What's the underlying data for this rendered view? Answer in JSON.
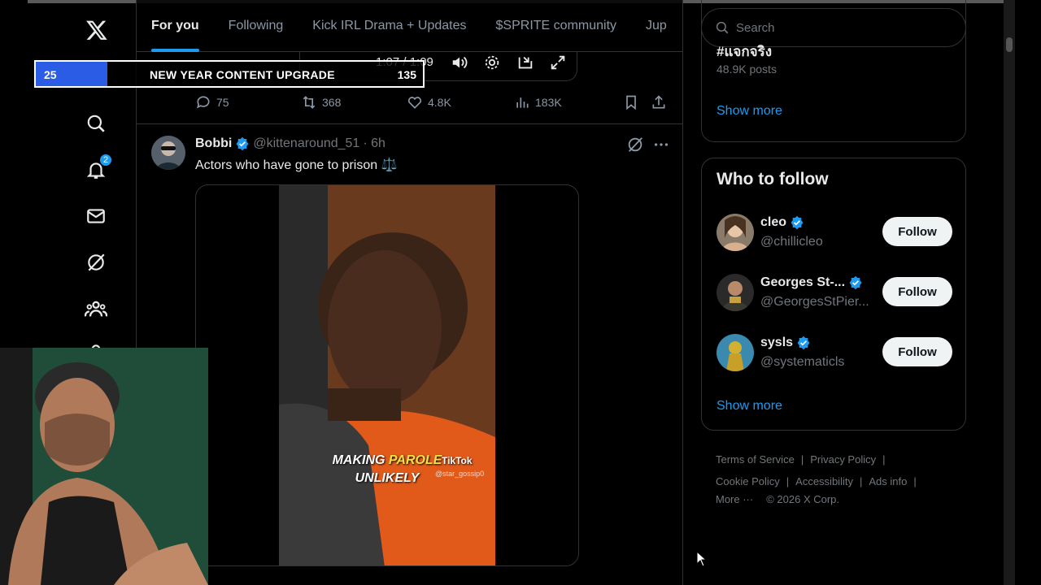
{
  "stream_overlay": {
    "current": "25",
    "goal": "135",
    "label": "NEW YEAR CONTENT UPGRADE",
    "progress": 0.185
  },
  "nav": {
    "notifications_badge": "2",
    "icons": [
      "x-logo-icon",
      "home-icon",
      "search-icon",
      "bell-icon",
      "mail-icon",
      "grok-icon",
      "communities-icon",
      "profile-icon"
    ]
  },
  "tabs": [
    {
      "label": "For you",
      "active": true
    },
    {
      "label": "Following"
    },
    {
      "label": "Kick IRL Drama + Updates"
    },
    {
      "label": "$SPRITE community"
    },
    {
      "label": "Jup"
    }
  ],
  "video_player": {
    "time": "1:07 / 1:09"
  },
  "prev_post_actions": {
    "replies": "75",
    "reposts": "368",
    "likes": "4.8K",
    "views": "183K"
  },
  "post": {
    "name": "Bobbi",
    "handle": "@kittenaround_51",
    "time": "· 6h",
    "text": "Actors who have gone to prison ⚖️",
    "caption_line1_a": "MAKING ",
    "caption_line1_b": "PAROLE",
    "caption_line2": "UNLIKELY",
    "tiktok": "TikTok",
    "tiktok_handle": "@star_gossip0"
  },
  "search": {
    "placeholder": "Search"
  },
  "trending": {
    "tag": "#แจกจริง",
    "posts": "48.9K posts",
    "show_more": "Show more"
  },
  "who_to_follow": {
    "title": "Who to follow",
    "show_more": "Show more",
    "users": [
      {
        "name": "cleo",
        "handle": "@chillicleo",
        "button": "Follow"
      },
      {
        "name": "Georges St-...",
        "handle": "@GeorgesStPier...",
        "button": "Follow"
      },
      {
        "name": "sysls",
        "handle": "@systematicls",
        "button": "Follow"
      }
    ]
  },
  "footer": {
    "terms": "Terms of Service",
    "privacy": "Privacy Policy",
    "cookie": "Cookie Policy",
    "accessibility": "Accessibility",
    "ads": "Ads info",
    "more": "More ···",
    "copyright": "© 2026 X Corp."
  },
  "colors": {
    "accent": "#1d9bf0",
    "background": "#000000",
    "border": "#2f3336",
    "overlay_fill": "#2a5ce6"
  }
}
